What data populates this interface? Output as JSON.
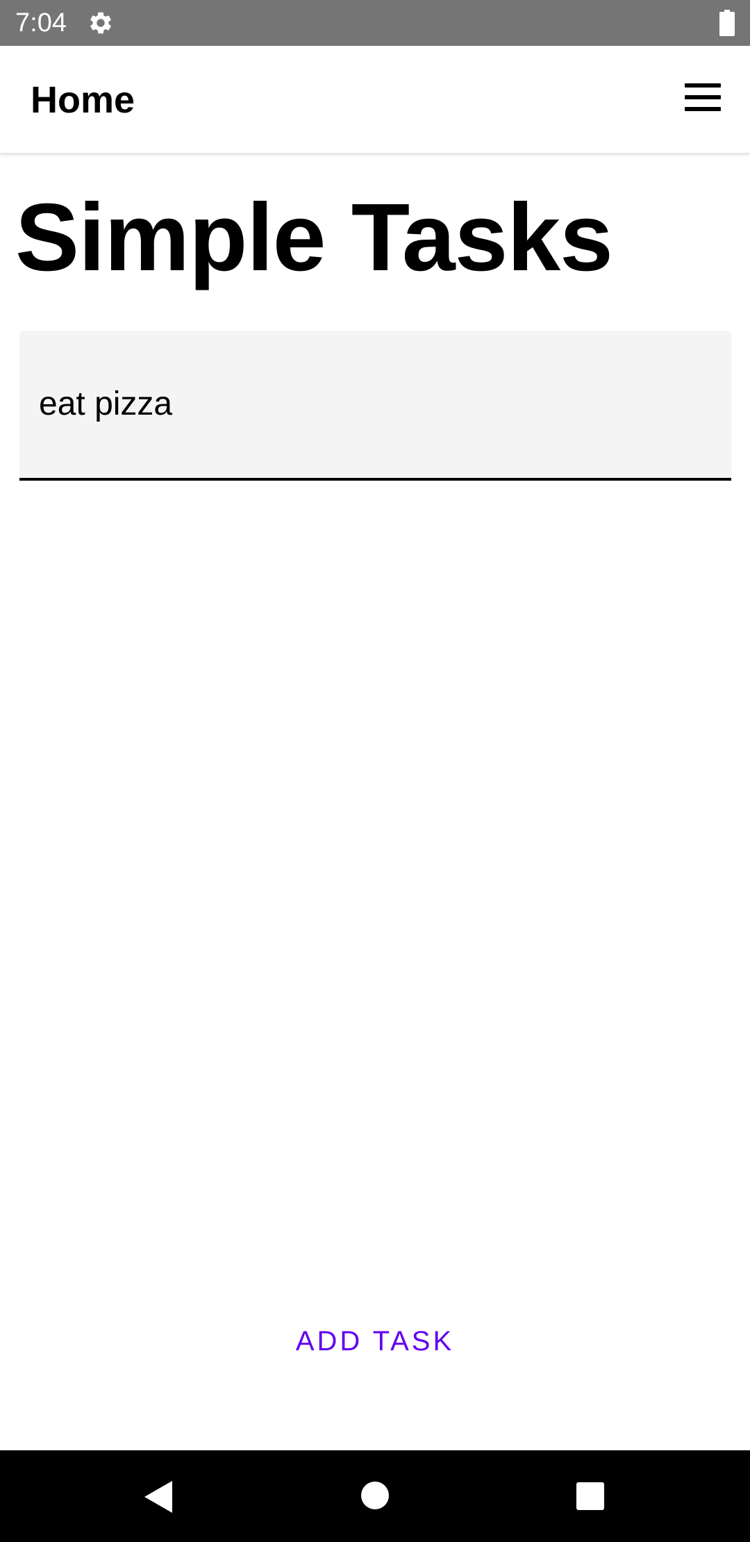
{
  "status_bar": {
    "time": "7:04",
    "settings_icon": "gear-icon",
    "battery_icon": "battery-icon"
  },
  "app_bar": {
    "title": "Home",
    "menu_icon": "hamburger-menu-icon"
  },
  "page": {
    "title": "Simple Tasks"
  },
  "task_field": {
    "value": "eat pizza"
  },
  "actions": {
    "add_task_label": "ADD TASK"
  },
  "nav_bar": {
    "back_icon": "back-triangle-icon",
    "home_icon": "home-circle-icon",
    "recents_icon": "recents-square-icon"
  },
  "colors": {
    "status_bar_bg": "#757575",
    "accent": "#6200ee",
    "field_bg": "#f4f4f4",
    "nav_bar_bg": "#000000"
  }
}
